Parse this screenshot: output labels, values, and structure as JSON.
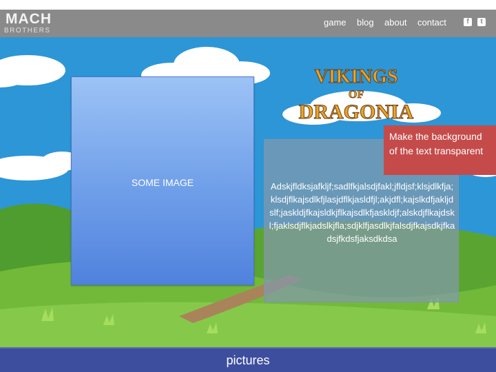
{
  "header": {
    "logo_line1": "MACH",
    "logo_line2": "BROTHERS",
    "nav": [
      "game",
      "blog",
      "about",
      "contact"
    ],
    "social_icons": [
      "facebook-icon",
      "twitter-icon"
    ]
  },
  "hero": {
    "game_title_line1": "VIKINGS",
    "game_title_line2": "OF",
    "game_title_line3": "DRAGONIA",
    "image_placeholder": "SOME IMAGE",
    "body_text": "Adskjfldksjafkljf;sadlfkjalsdjfakl;jfldjsf;klsjdlkfja;klsdjflkajsdlkfjlasjdflkjasldfjl;akjdfl;kajslkdfjakljdslf;jaskldjfkajsldkjflkajsdlkfjaskldjf;alskdjflkajdskl;fjaklsdjflkjadslkjfla;sdjklfjasdlkjfalsdjfkajsdkjfkadsjfkdsfjaksdkdsa",
    "annotation": "Make the background of the text transparent"
  },
  "footer": {
    "label": "pictures"
  },
  "colors": {
    "navbar": "#8a8a8a",
    "sky": "#2d96d6",
    "footer": "#3e4e9e",
    "annotation": "#c54b4b"
  }
}
